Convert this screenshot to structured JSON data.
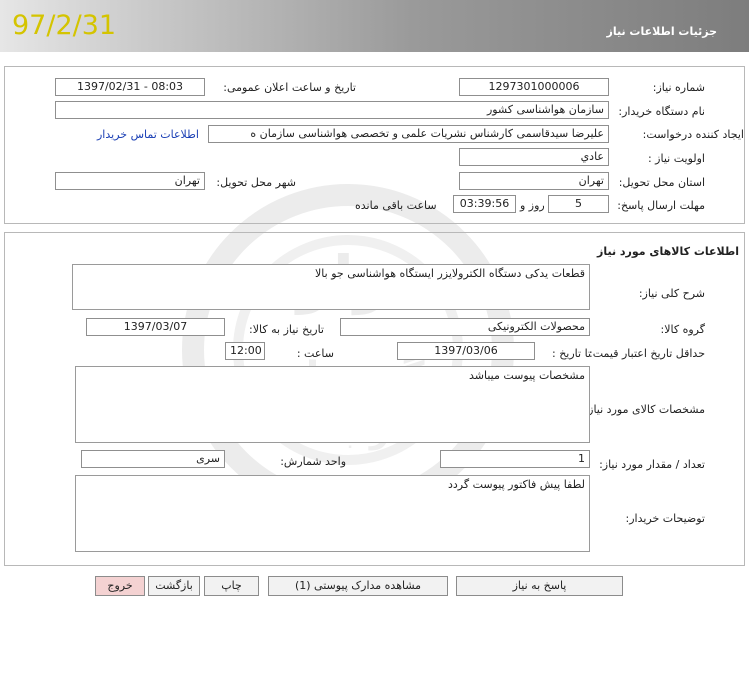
{
  "header": {
    "title": "جزئیات اطلاعات نیاز",
    "date": "97/2/31"
  },
  "need_info": {
    "need_number_label": "شماره نیاز:",
    "need_number": "1297301000006",
    "announce_datetime_label": "تاریخ و ساعت اعلان عمومی:",
    "announce_datetime": "1397/02/31 - 08:03",
    "buyer_org_label": "نام دستگاه خریدار:",
    "buyer_org": "سازمان هواشناسی کشور",
    "creator_label": "ایجاد کننده درخواست:",
    "creator": "علیرضا سیدقاسمی کارشناس نشریات علمی و تخصصی هواشناسی سازمان ه",
    "contact_link": "اطلاعات تماس خریدار",
    "priority_label": "اولویت نیاز :",
    "priority": "عادي",
    "province_label": "استان محل تحویل:",
    "province": "تهران",
    "city_label": "شهر محل تحویل:",
    "city": "تهران",
    "deadline_label": "مهلت ارسال پاسخ:",
    "deadline_days": "5",
    "days_and_label": "روز و",
    "deadline_time": "03:39:56",
    "remaining_label": "ساعت باقی مانده"
  },
  "goods": {
    "section_title": "اطلاعات کالاهای مورد نیاز",
    "general_desc_label": "شرح کلی نیاز:",
    "general_desc": "قطعات یدکی دستگاه الکترولایزر ایستگاه هواشناسی جو بالا",
    "goods_group_label": "گروه کالا:",
    "goods_group": "محصولات الکترونیکی",
    "need_date_label": "تاریخ نیاز به کالا:",
    "need_date": "1397/03/07",
    "price_validity_label": "حداقل تاریخ اعتبار قیمت:",
    "until_date_label": "تا تاریخ :",
    "until_date": "1397/03/06",
    "time_label": "ساعت :",
    "time": "12:00",
    "specs_label": "مشخصات کالای مورد نیاز:",
    "specs": "مشخصات پیوست میباشد",
    "quantity_label": "تعداد / مقدار مورد نیاز:",
    "quantity": "1",
    "unit_label": "واحد شمارش:",
    "unit": "سری",
    "buyer_notes_label": "توضیحات خریدار:",
    "buyer_notes": "لطفا پیش فاکتور پیوست گردد"
  },
  "buttons": {
    "reply": "پاسخ به نیاز",
    "view_docs": "مشاهده مدارک پیوستی (1)",
    "print": "چاپ",
    "back": "بازگشت",
    "exit": "خروج"
  },
  "watermark": {
    "text_top": "هزاره",
    "text_bottom": "گستران",
    "text_small": "ارتباط"
  }
}
